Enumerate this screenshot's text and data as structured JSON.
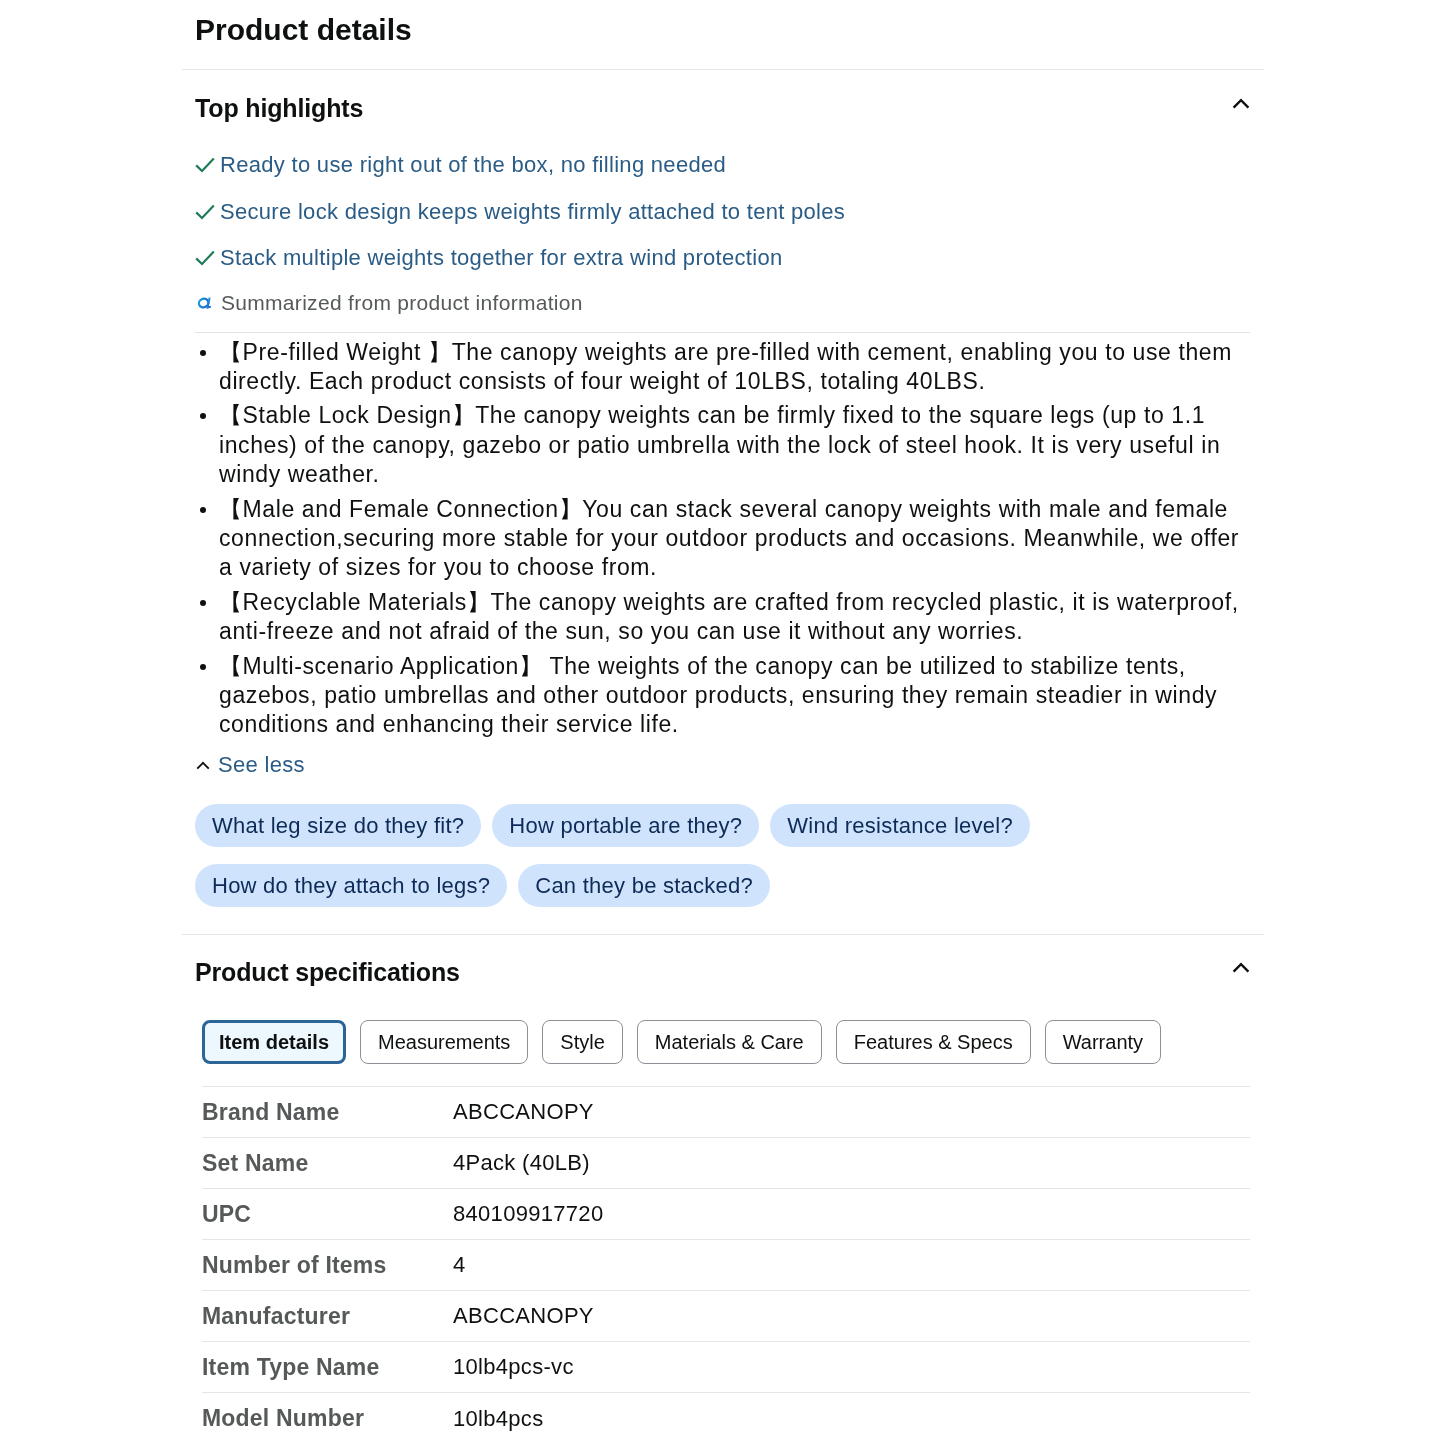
{
  "page_title": "Product details",
  "highlights": {
    "title": "Top highlights",
    "expanded": true,
    "items": [
      "Ready to use right out of the box, no filling needed",
      "Secure lock design keeps weights firmly attached to tent poles",
      "Stack multiple weights together for extra wind protection"
    ],
    "source_note": "Summarized from product information"
  },
  "description": {
    "bullets": [
      "【Pre-filled Weight 】The canopy weights are pre-filled with cement, enabling you to use them directly. Each product consists of four weight of 10LBS, totaling 40LBS.",
      "【Stable Lock Design】The canopy weights can be firmly fixed to the square legs (up to 1.1 inches) of the canopy, gazebo or patio umbrella with the lock of steel hook. It is very useful in windy weather.",
      "【Male and Female Connection】You can stack several canopy weights with male and female connection,securing more stable for your outdoor products and occasions. Meanwhile, we offer a variety of sizes for you to choose from.",
      "【Recyclable Materials】The canopy weights are crafted from recycled plastic, it is waterproof, anti-freeze and not afraid of the sun, so you can use it without any worries.",
      "【Multi-scenario Application】 The weights of the canopy can be utilized to stabilize tents, gazebos, patio umbrellas and other outdoor products, ensuring they remain steadier in windy conditions and enhancing their service life."
    ],
    "expanded": true,
    "toggle": "See less"
  },
  "suggested_questions": [
    "What leg size do they fit?",
    "How portable are they?",
    "Wind resistance level?",
    "How do they attach to legs?",
    "Can they be stacked?"
  ],
  "specifications": {
    "title": "Product specifications",
    "expanded": true,
    "tabs": [
      {
        "label": "Item details",
        "selected": true
      },
      {
        "label": "Measurements",
        "selected": false
      },
      {
        "label": "Style",
        "selected": false
      },
      {
        "label": "Materials & Care",
        "selected": false
      },
      {
        "label": "Features & Specs",
        "selected": false
      },
      {
        "label": "Warranty",
        "selected": false
      }
    ],
    "rows": [
      {
        "label": "Brand Name",
        "value": "ABCCANOPY"
      },
      {
        "label": "Set Name",
        "value": "4Pack (40LB)"
      },
      {
        "label": "UPC",
        "value": "840109917720"
      },
      {
        "label": "Number of Items",
        "value": "4"
      },
      {
        "label": "Manufacturer",
        "value": "ABCCANOPY"
      },
      {
        "label": "Item Type Name",
        "value": "10lb4pcs-vc"
      },
      {
        "label": "Model Number",
        "value": "10lb4pcs"
      }
    ]
  }
}
